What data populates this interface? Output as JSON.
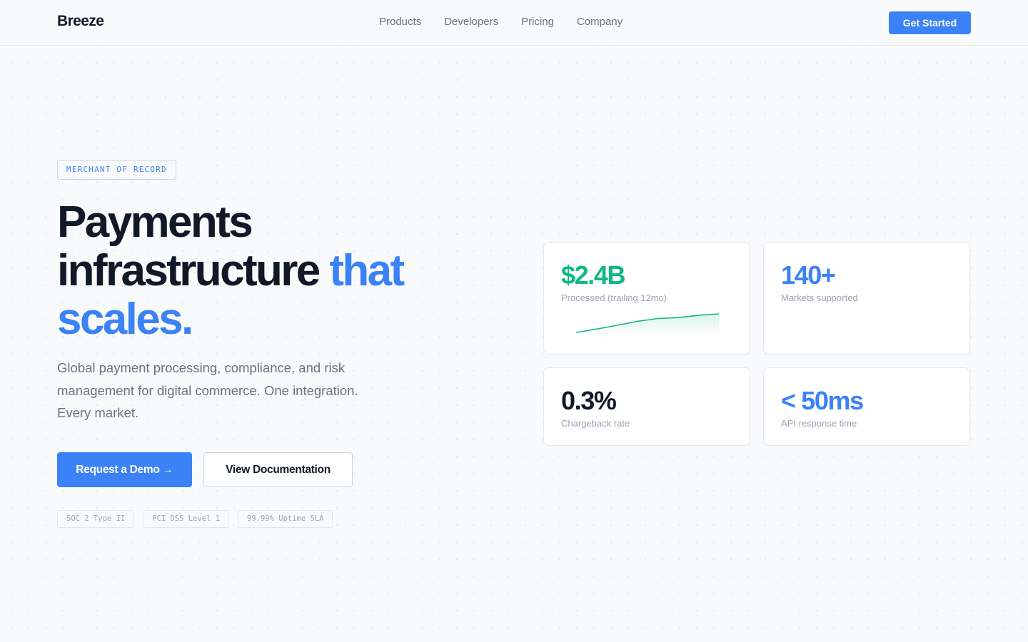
{
  "brand": {
    "name": "Breeze"
  },
  "nav": {
    "links": [
      "Products",
      "Developers",
      "Pricing",
      "Company"
    ],
    "cta_label": "Get Started"
  },
  "hero": {
    "badge": "MERCHANT OF RECORD",
    "headline_part1": "Payments infrastructure ",
    "headline_accent": "that scales.",
    "lede": "Global payment processing, compliance, and risk management for digital commerce. One integration. Every market.",
    "primary_cta": "Request a Demo →",
    "secondary_cta": "View Documentation",
    "certifications": [
      "SOC 2 Type II",
      "PCI DSS Level 1",
      "99.99% Uptime SLA"
    ]
  },
  "stats": [
    {
      "value": "$2.4B",
      "label": "Processed (trailing 12mo)",
      "color": "#10b981"
    },
    {
      "value": "140+",
      "label": "Markets supported",
      "color": "#3b82f6"
    },
    {
      "value": "0.3%",
      "label": "Chargeback rate",
      "color": "#111827"
    },
    {
      "value": "< 50ms",
      "label": "API response time",
      "color": "#3b82f6"
    }
  ],
  "sparkline": {
    "values": [
      0.0,
      0.18,
      0.38,
      0.6,
      0.75,
      0.8,
      0.92,
      1.0
    ],
    "color": "#10b981"
  },
  "colors": {
    "accent": "#3b82f6",
    "success": "#10b981",
    "text_primary": "#111827",
    "text_muted": "#6b7280",
    "border": "#e5e7eb",
    "background": "#f9fafb"
  }
}
